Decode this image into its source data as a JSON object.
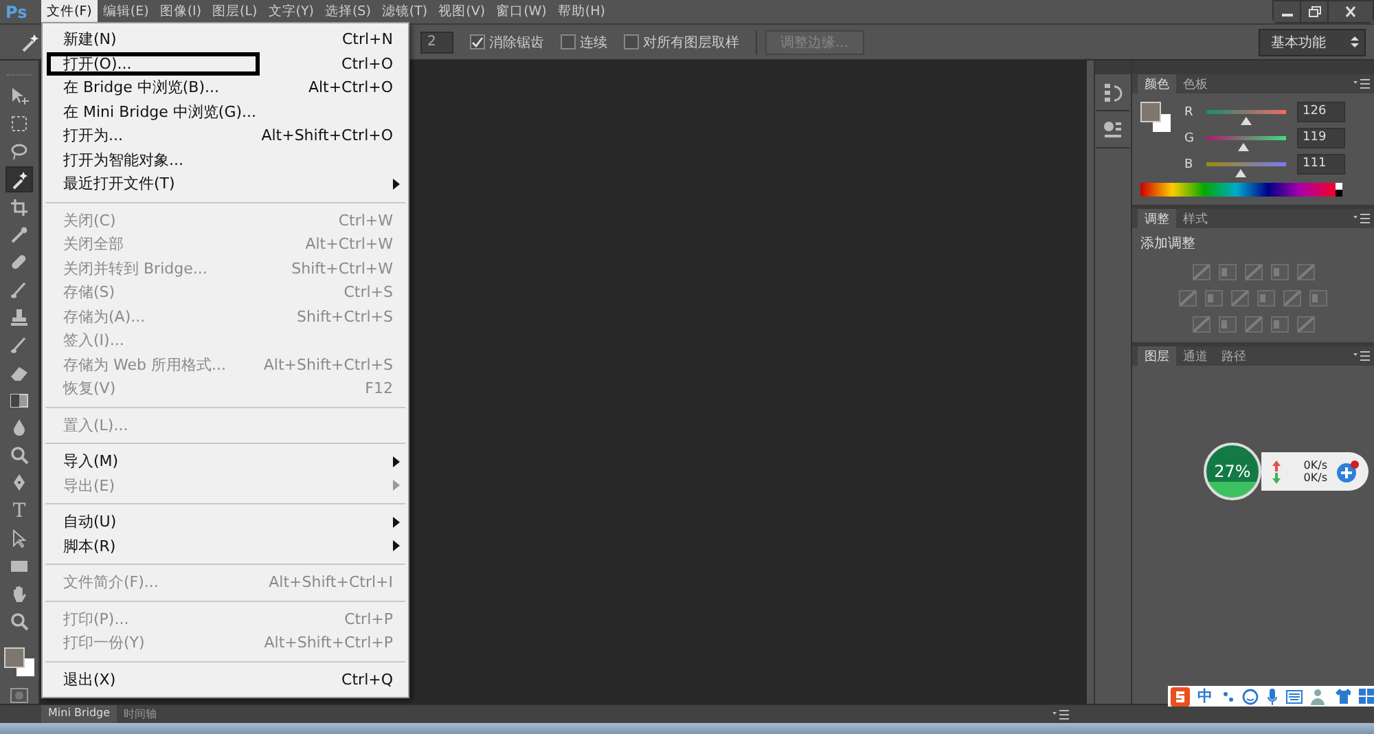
{
  "app": {
    "logo": "Ps"
  },
  "menubar": [
    {
      "label": "文件(F)",
      "selected": true
    },
    {
      "label": "编辑(E)",
      "selected": false
    },
    {
      "label": "图像(I)",
      "selected": false
    },
    {
      "label": "图层(L)",
      "selected": false
    },
    {
      "label": "文字(Y)",
      "selected": false
    },
    {
      "label": "选择(S)",
      "selected": false
    },
    {
      "label": "滤镜(T)",
      "selected": false
    },
    {
      "label": "视图(V)",
      "selected": false
    },
    {
      "label": "窗口(W)",
      "selected": false
    },
    {
      "label": "帮助(H)",
      "selected": false
    }
  ],
  "options_bar": {
    "tolerance": "2",
    "checkboxes": [
      {
        "label": "消除锯齿",
        "checked": true
      },
      {
        "label": "连续",
        "checked": false
      },
      {
        "label": "对所有图层取样",
        "checked": false
      }
    ],
    "refine_button": {
      "label": "调整边缘...",
      "disabled": true
    },
    "workspace": "基本功能"
  },
  "file_menu": [
    {
      "kind": "item",
      "label": "新建(N)",
      "shortcut": "Ctrl+N",
      "disabled": false,
      "submenu": false,
      "outlined": false
    },
    {
      "kind": "item",
      "label": "打开(O)...",
      "shortcut": "Ctrl+O",
      "disabled": false,
      "submenu": false,
      "outlined": true
    },
    {
      "kind": "item",
      "label": "在 Bridge 中浏览(B)...",
      "shortcut": "Alt+Ctrl+O",
      "disabled": false,
      "submenu": false,
      "outlined": false
    },
    {
      "kind": "item",
      "label": "在 Mini Bridge 中浏览(G)...",
      "disabled": false,
      "submenu": false,
      "outlined": false
    },
    {
      "kind": "item",
      "label": "打开为...",
      "shortcut": "Alt+Shift+Ctrl+O",
      "disabled": false,
      "submenu": false,
      "outlined": false
    },
    {
      "kind": "item",
      "label": "打开为智能对象...",
      "disabled": false,
      "submenu": false,
      "outlined": false
    },
    {
      "kind": "item",
      "label": "最近打开文件(T)",
      "disabled": false,
      "submenu": true,
      "outlined": false
    },
    {
      "kind": "separator"
    },
    {
      "kind": "item",
      "label": "关闭(C)",
      "shortcut": "Ctrl+W",
      "disabled": true,
      "submenu": false,
      "outlined": false
    },
    {
      "kind": "item",
      "label": "关闭全部",
      "shortcut": "Alt+Ctrl+W",
      "disabled": true,
      "submenu": false,
      "outlined": false
    },
    {
      "kind": "item",
      "label": "关闭并转到 Bridge...",
      "shortcut": "Shift+Ctrl+W",
      "disabled": true,
      "submenu": false,
      "outlined": false
    },
    {
      "kind": "item",
      "label": "存储(S)",
      "shortcut": "Ctrl+S",
      "disabled": true,
      "submenu": false,
      "outlined": false
    },
    {
      "kind": "item",
      "label": "存储为(A)...",
      "shortcut": "Shift+Ctrl+S",
      "disabled": true,
      "submenu": false,
      "outlined": false
    },
    {
      "kind": "item",
      "label": "签入(I)...",
      "disabled": true,
      "submenu": false,
      "outlined": false
    },
    {
      "kind": "item",
      "label": "存储为 Web 所用格式...",
      "shortcut": "Alt+Shift+Ctrl+S",
      "disabled": true,
      "submenu": false,
      "outlined": false
    },
    {
      "kind": "item",
      "label": "恢复(V)",
      "shortcut": "F12",
      "disabled": true,
      "submenu": false,
      "outlined": false
    },
    {
      "kind": "separator"
    },
    {
      "kind": "item",
      "label": "置入(L)...",
      "disabled": true,
      "submenu": false,
      "outlined": false
    },
    {
      "kind": "separator"
    },
    {
      "kind": "item",
      "label": "导入(M)",
      "disabled": false,
      "submenu": true,
      "outlined": false
    },
    {
      "kind": "item",
      "label": "导出(E)",
      "disabled": true,
      "submenu": true,
      "outlined": false
    },
    {
      "kind": "separator"
    },
    {
      "kind": "item",
      "label": "自动(U)",
      "disabled": false,
      "submenu": true,
      "outlined": false
    },
    {
      "kind": "item",
      "label": "脚本(R)",
      "disabled": false,
      "submenu": true,
      "outlined": false
    },
    {
      "kind": "separator"
    },
    {
      "kind": "item",
      "label": "文件简介(F)...",
      "shortcut": "Alt+Shift+Ctrl+I",
      "disabled": true,
      "submenu": false,
      "outlined": false
    },
    {
      "kind": "separator"
    },
    {
      "kind": "item",
      "label": "打印(P)...",
      "shortcut": "Ctrl+P",
      "disabled": true,
      "submenu": false,
      "outlined": false
    },
    {
      "kind": "item",
      "label": "打印一份(Y)",
      "shortcut": "Alt+Shift+Ctrl+P",
      "disabled": true,
      "submenu": false,
      "outlined": false
    },
    {
      "kind": "separator"
    },
    {
      "kind": "item",
      "label": "退出(X)",
      "shortcut": "Ctrl+Q",
      "disabled": false,
      "submenu": false,
      "outlined": false
    }
  ],
  "tools": [
    {
      "kind": "move",
      "selected": false
    },
    {
      "kind": "marquee",
      "selected": false
    },
    {
      "kind": "lasso",
      "selected": false
    },
    {
      "kind": "wand",
      "selected": true
    },
    {
      "kind": "crop",
      "selected": false
    },
    {
      "kind": "eyedropper",
      "selected": false
    },
    {
      "kind": "bandage",
      "selected": false
    },
    {
      "kind": "brush",
      "selected": false
    },
    {
      "kind": "stamp",
      "selected": false
    },
    {
      "kind": "brush",
      "selected": false
    },
    {
      "kind": "eraser",
      "selected": false
    },
    {
      "kind": "gradient",
      "selected": false
    },
    {
      "kind": "drop",
      "selected": false
    },
    {
      "kind": "zoom",
      "selected": false
    },
    {
      "kind": "pen",
      "selected": false
    },
    {
      "kind": "type",
      "label": "T",
      "selected": false
    },
    {
      "kind": "arrow",
      "selected": false
    },
    {
      "kind": "rect",
      "selected": false
    },
    {
      "kind": "hand",
      "selected": false
    },
    {
      "kind": "zoom",
      "selected": false
    }
  ],
  "color_panel": {
    "tabs": [
      {
        "label": "颜色",
        "selected": true
      },
      {
        "label": "色板",
        "selected": false
      }
    ],
    "channels": [
      {
        "name": "R",
        "level": 0.494,
        "value": "126"
      },
      {
        "name": "G",
        "level": 0.467,
        "value": "119"
      },
      {
        "name": "B",
        "level": 0.435,
        "value": "111"
      }
    ]
  },
  "adjustments_panel": {
    "tabs": [
      {
        "label": "调整",
        "selected": true
      },
      {
        "label": "样式",
        "selected": false
      }
    ],
    "heading": "添加调整"
  },
  "layers_panel": {
    "tabs": [
      {
        "label": "图层",
        "selected": true
      },
      {
        "label": "通道",
        "selected": false
      },
      {
        "label": "路径",
        "selected": false
      }
    ]
  },
  "speed_widget": {
    "percent": "27%",
    "upload": "0K/s",
    "download": "0K/s"
  },
  "ime_bar": {
    "mode": "中"
  },
  "bottom_tabs": [
    {
      "label": "Mini Bridge",
      "selected": true
    },
    {
      "label": "时间轴",
      "selected": false
    }
  ]
}
